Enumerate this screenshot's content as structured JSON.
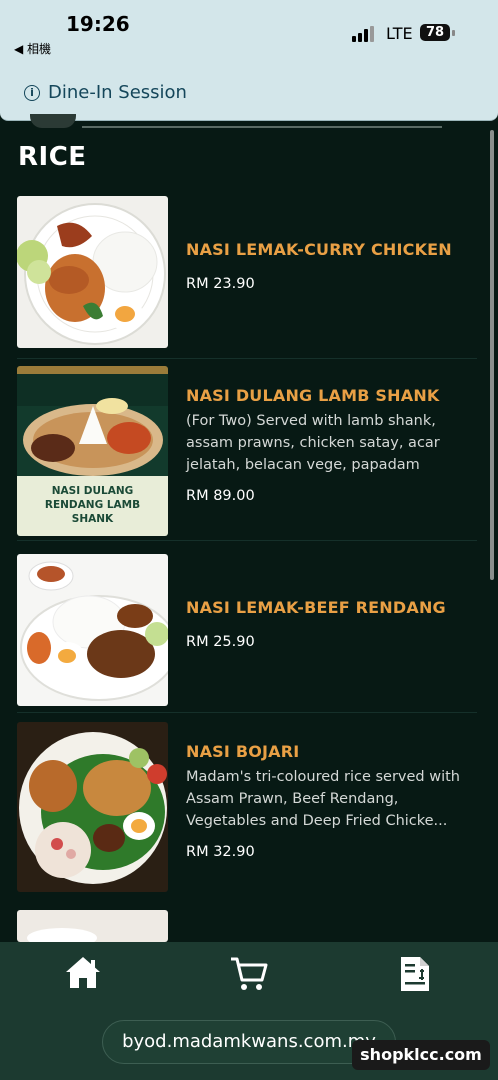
{
  "status_bar": {
    "time": "19:26",
    "back_label": "◀ 相機",
    "network": "LTE",
    "battery": "78"
  },
  "session": {
    "info_glyph": "i",
    "label": "Dine-In Session"
  },
  "section": {
    "title": "RICE"
  },
  "items": [
    {
      "name": "NASI LEMAK-CURRY CHICKEN",
      "description": "",
      "price": "RM 23.90"
    },
    {
      "name": "NASI DULANG LAMB SHANK",
      "description": "(For Two) Served with lamb shank, assam prawns, chicken satay, acar jelatah, belacan vege, papadam",
      "price": "RM 89.00",
      "image_text": "NASI DULANG RENDANG LAMB SHANK"
    },
    {
      "name": "NASI LEMAK-BEEF RENDANG",
      "description": "",
      "price": "RM 25.90"
    },
    {
      "name": "NASI BOJARI",
      "description": "Madam's tri-coloured rice served with Assam Prawn, Beef Rendang, Vegetables and Deep Fried Chicke...",
      "price": "RM 32.90"
    }
  ],
  "nav": {
    "home_icon": "home-icon",
    "cart_icon": "cart-icon",
    "orders_icon": "receipt-icon"
  },
  "browser": {
    "url": "byod.madamkwans.com.my"
  },
  "watermark": "shopklcc.com",
  "colors": {
    "background": "#071914",
    "accent": "#e9a045",
    "banner": "#d3e6ea",
    "nav": "#1c3a30"
  }
}
